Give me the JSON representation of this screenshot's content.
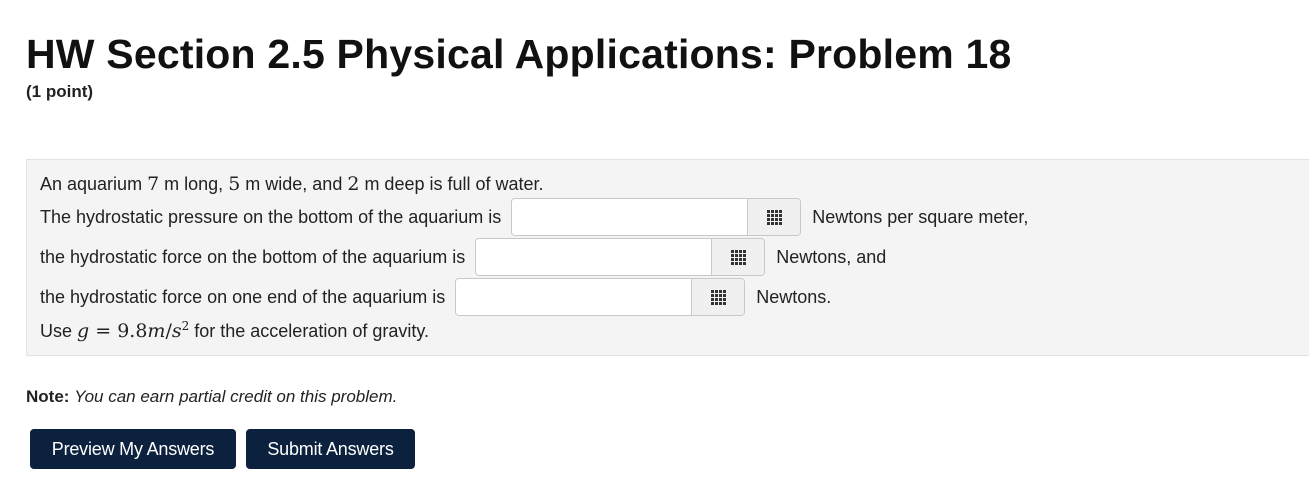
{
  "header": {
    "title": "HW Section 2.5 Physical Applications: Problem 18",
    "points": "(1 point)"
  },
  "problem": {
    "intro": {
      "p1": "An aquarium ",
      "length": "7",
      "p2": " m long, ",
      "width": "5",
      "p3": " m wide, and ",
      "depth": "2",
      "p4": " m deep is full of water."
    },
    "answers": [
      {
        "label": "The hydrostatic pressure on the bottom of the aquarium is",
        "value": "",
        "unit": "Newtons per square meter,"
      },
      {
        "label": "the hydrostatic force on the bottom of the aquarium is",
        "value": "",
        "unit": "Newtons, and"
      },
      {
        "label": "the hydrostatic force on one end of the aquarium is",
        "value": "",
        "unit": "Newtons."
      }
    ],
    "gravity": {
      "pre": "Use ",
      "var": "g",
      "eq": " = ",
      "val": "9.8",
      "unit_m": "m",
      "slash": "/",
      "unit_s": "s",
      "exp": "2",
      "post": " for the acceleration of gravity."
    },
    "math_icon": "grid-icon"
  },
  "note": {
    "label": "Note:",
    "text": "You can earn partial credit on this problem."
  },
  "buttons": {
    "preview": "Preview My Answers",
    "submit": "Submit Answers"
  },
  "colors": {
    "button_bg": "#0b213e",
    "panel_bg": "#f4f4f4"
  }
}
